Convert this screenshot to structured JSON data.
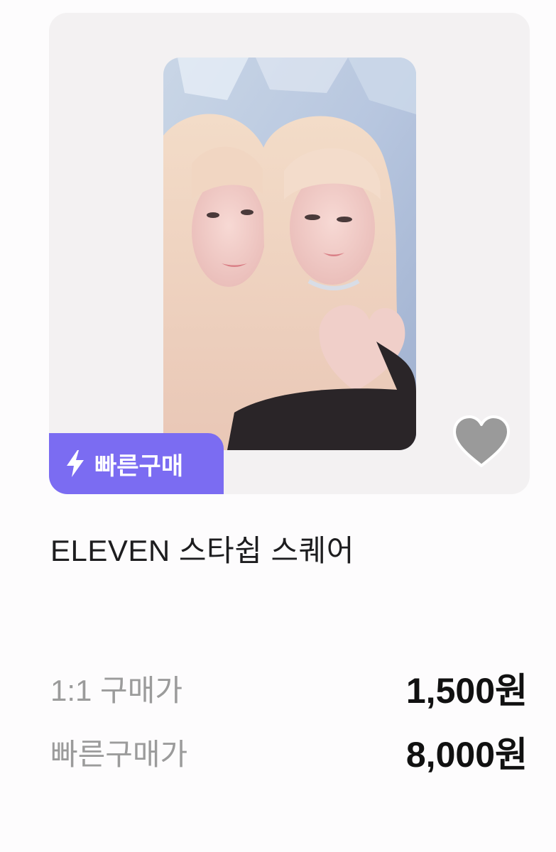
{
  "product": {
    "title": "ELEVEN 스타쉽 스퀘어",
    "image_alt": "photocard",
    "badge": {
      "label": "빠른구매",
      "icon": "lightning-bolt-icon",
      "color": "#7b6cf2"
    },
    "favorite_icon": "heart-icon",
    "favorite_color": "#9a9a9a"
  },
  "prices": [
    {
      "label": "1:1 구매가",
      "value": "1,500원"
    },
    {
      "label": "빠른구매가",
      "value": "8,000원"
    }
  ]
}
